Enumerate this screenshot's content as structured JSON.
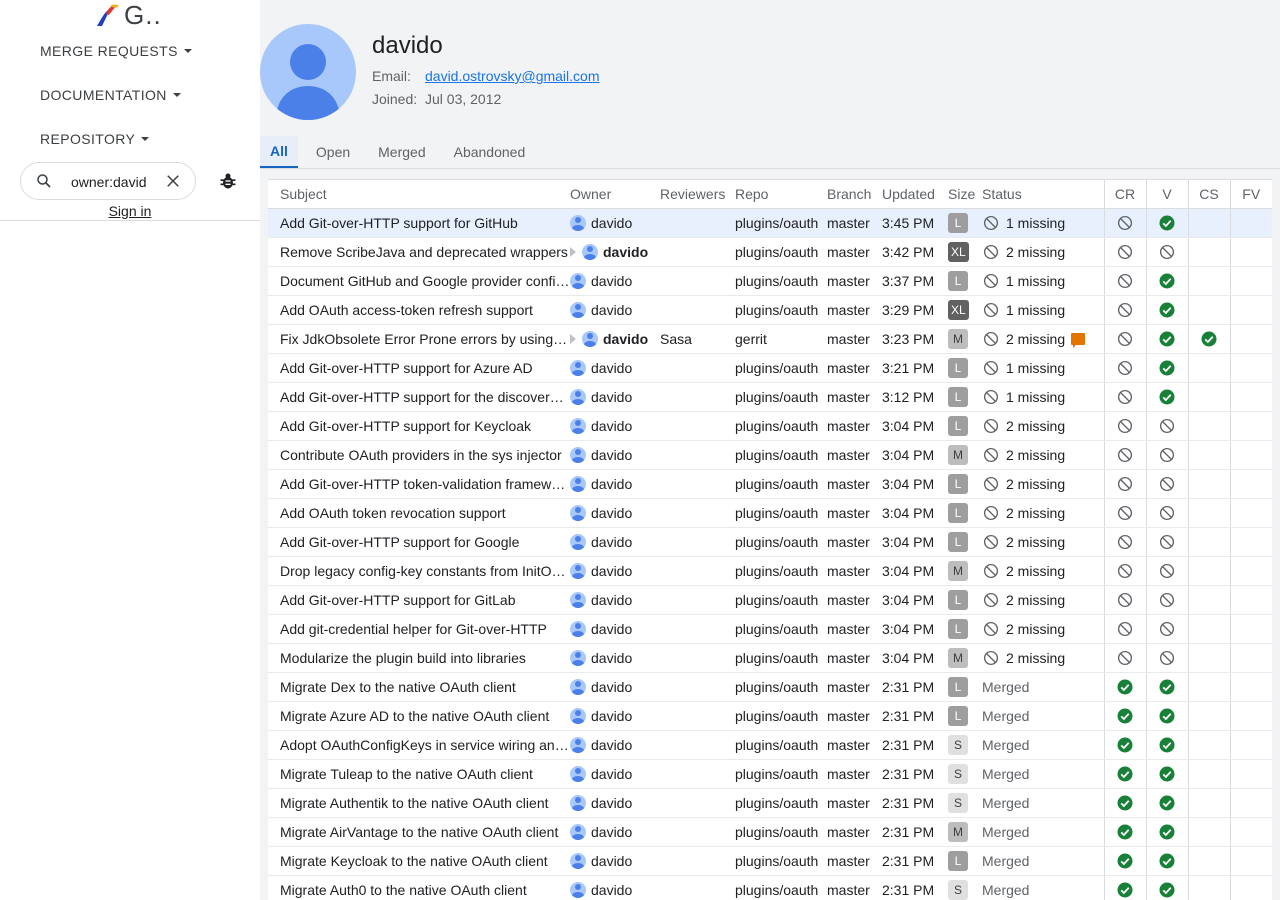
{
  "app": {
    "title": "G.."
  },
  "nav": {
    "merge_requests": "MERGE REQUESTS",
    "documentation": "DOCUMENTATION",
    "repository": "REPOSITORY"
  },
  "search": {
    "value": "owner:davido"
  },
  "auth": {
    "sign_in": "Sign in"
  },
  "user": {
    "name": "davido",
    "email_label": "Email:",
    "email": "david.ostrovsky@gmail.com",
    "joined_label": "Joined:",
    "joined": "Jul 03, 2012"
  },
  "tabs": [
    "All",
    "Open",
    "Merged",
    "Abandoned"
  ],
  "active_tab": "All",
  "table": {
    "headers": {
      "subject": "Subject",
      "owner": "Owner",
      "reviewers": "Reviewers",
      "repo": "Repo",
      "branch": "Branch",
      "updated": "Updated",
      "size": "Size",
      "status": "Status",
      "cr": "CR",
      "v": "V",
      "cs": "CS",
      "fv": "FV"
    },
    "rows": [
      {
        "subject": "Add Git-over-HTTP support for GitHub",
        "owner": "davido",
        "attention": false,
        "reviewers": "",
        "repo": "plugins/oauth",
        "branch": "master",
        "updated": "3:45 PM",
        "size": "L",
        "status": "1 missing",
        "status_type": "missing",
        "comment": false,
        "cr": "blocked",
        "v": "ok",
        "cs": "",
        "fv": "",
        "selected": true
      },
      {
        "subject": "Remove ScribeJava and deprecated wrappers",
        "owner": "davido",
        "attention": true,
        "reviewers": "",
        "repo": "plugins/oauth",
        "branch": "master",
        "updated": "3:42 PM",
        "size": "XL",
        "status": "2 missing",
        "status_type": "missing",
        "comment": false,
        "cr": "blocked",
        "v": "blocked",
        "cs": "",
        "fv": ""
      },
      {
        "subject": "Document GitHub and Google provider confi…",
        "owner": "davido",
        "attention": false,
        "reviewers": "",
        "repo": "plugins/oauth",
        "branch": "master",
        "updated": "3:37 PM",
        "size": "L",
        "status": "1 missing",
        "status_type": "missing",
        "comment": false,
        "cr": "blocked",
        "v": "ok",
        "cs": "",
        "fv": ""
      },
      {
        "subject": "Add OAuth access-token refresh support",
        "owner": "davido",
        "attention": false,
        "reviewers": "",
        "repo": "plugins/oauth",
        "branch": "master",
        "updated": "3:29 PM",
        "size": "XL",
        "status": "1 missing",
        "status_type": "missing",
        "comment": false,
        "cr": "blocked",
        "v": "ok",
        "cs": "",
        "fv": ""
      },
      {
        "subject": "Fix JdkObsolete Error Prone errors by using …",
        "owner": "davido",
        "attention": true,
        "reviewers": "Sasa",
        "repo": "gerrit",
        "branch": "master",
        "updated": "3:23 PM",
        "size": "M",
        "status": "2 missing",
        "status_type": "missing",
        "comment": true,
        "cr": "blocked",
        "v": "ok",
        "cs": "ok",
        "fv": ""
      },
      {
        "subject": "Add Git-over-HTTP support for Azure AD",
        "owner": "davido",
        "attention": false,
        "reviewers": "",
        "repo": "plugins/oauth",
        "branch": "master",
        "updated": "3:21 PM",
        "size": "L",
        "status": "1 missing",
        "status_type": "missing",
        "comment": false,
        "cr": "blocked",
        "v": "ok",
        "cs": "",
        "fv": ""
      },
      {
        "subject": "Add Git-over-HTTP support for the discovery…",
        "owner": "davido",
        "attention": false,
        "reviewers": "",
        "repo": "plugins/oauth",
        "branch": "master",
        "updated": "3:12 PM",
        "size": "L",
        "status": "1 missing",
        "status_type": "missing",
        "comment": false,
        "cr": "blocked",
        "v": "ok",
        "cs": "",
        "fv": ""
      },
      {
        "subject": "Add Git-over-HTTP support for Keycloak",
        "owner": "davido",
        "attention": false,
        "reviewers": "",
        "repo": "plugins/oauth",
        "branch": "master",
        "updated": "3:04 PM",
        "size": "L",
        "status": "2 missing",
        "status_type": "missing",
        "comment": false,
        "cr": "blocked",
        "v": "blocked",
        "cs": "",
        "fv": ""
      },
      {
        "subject": "Contribute OAuth providers in the sys injector",
        "owner": "davido",
        "attention": false,
        "reviewers": "",
        "repo": "plugins/oauth",
        "branch": "master",
        "updated": "3:04 PM",
        "size": "M",
        "status": "2 missing",
        "status_type": "missing",
        "comment": false,
        "cr": "blocked",
        "v": "blocked",
        "cs": "",
        "fv": ""
      },
      {
        "subject": "Add Git-over-HTTP token-validation framework",
        "owner": "davido",
        "attention": false,
        "reviewers": "",
        "repo": "plugins/oauth",
        "branch": "master",
        "updated": "3:04 PM",
        "size": "L",
        "status": "2 missing",
        "status_type": "missing",
        "comment": false,
        "cr": "blocked",
        "v": "blocked",
        "cs": "",
        "fv": ""
      },
      {
        "subject": "Add OAuth token revocation support",
        "owner": "davido",
        "attention": false,
        "reviewers": "",
        "repo": "plugins/oauth",
        "branch": "master",
        "updated": "3:04 PM",
        "size": "L",
        "status": "2 missing",
        "status_type": "missing",
        "comment": false,
        "cr": "blocked",
        "v": "blocked",
        "cs": "",
        "fv": ""
      },
      {
        "subject": "Add Git-over-HTTP support for Google",
        "owner": "davido",
        "attention": false,
        "reviewers": "",
        "repo": "plugins/oauth",
        "branch": "master",
        "updated": "3:04 PM",
        "size": "L",
        "status": "2 missing",
        "status_type": "missing",
        "comment": false,
        "cr": "blocked",
        "v": "blocked",
        "cs": "",
        "fv": ""
      },
      {
        "subject": "Drop legacy config-key constants from InitO…",
        "owner": "davido",
        "attention": false,
        "reviewers": "",
        "repo": "plugins/oauth",
        "branch": "master",
        "updated": "3:04 PM",
        "size": "M",
        "status": "2 missing",
        "status_type": "missing",
        "comment": false,
        "cr": "blocked",
        "v": "blocked",
        "cs": "",
        "fv": ""
      },
      {
        "subject": "Add Git-over-HTTP support for GitLab",
        "owner": "davido",
        "attention": false,
        "reviewers": "",
        "repo": "plugins/oauth",
        "branch": "master",
        "updated": "3:04 PM",
        "size": "L",
        "status": "2 missing",
        "status_type": "missing",
        "comment": false,
        "cr": "blocked",
        "v": "blocked",
        "cs": "",
        "fv": ""
      },
      {
        "subject": "Add git-credential helper for Git-over-HTTP",
        "owner": "davido",
        "attention": false,
        "reviewers": "",
        "repo": "plugins/oauth",
        "branch": "master",
        "updated": "3:04 PM",
        "size": "L",
        "status": "2 missing",
        "status_type": "missing",
        "comment": false,
        "cr": "blocked",
        "v": "blocked",
        "cs": "",
        "fv": ""
      },
      {
        "subject": "Modularize the plugin build into libraries",
        "owner": "davido",
        "attention": false,
        "reviewers": "",
        "repo": "plugins/oauth",
        "branch": "master",
        "updated": "3:04 PM",
        "size": "M",
        "status": "2 missing",
        "status_type": "missing",
        "comment": false,
        "cr": "blocked",
        "v": "blocked",
        "cs": "",
        "fv": ""
      },
      {
        "subject": "Migrate Dex to the native OAuth client",
        "owner": "davido",
        "attention": false,
        "reviewers": "",
        "repo": "plugins/oauth",
        "branch": "master",
        "updated": "2:31 PM",
        "size": "L",
        "status": "Merged",
        "status_type": "merged",
        "comment": false,
        "cr": "ok",
        "v": "ok",
        "cs": "",
        "fv": ""
      },
      {
        "subject": "Migrate Azure AD to the native OAuth client",
        "owner": "davido",
        "attention": false,
        "reviewers": "",
        "repo": "plugins/oauth",
        "branch": "master",
        "updated": "2:31 PM",
        "size": "L",
        "status": "Merged",
        "status_type": "merged",
        "comment": false,
        "cr": "ok",
        "v": "ok",
        "cs": "",
        "fv": ""
      },
      {
        "subject": "Adopt OAuthConfigKeys in service wiring an…",
        "owner": "davido",
        "attention": false,
        "reviewers": "",
        "repo": "plugins/oauth",
        "branch": "master",
        "updated": "2:31 PM",
        "size": "S",
        "status": "Merged",
        "status_type": "merged",
        "comment": false,
        "cr": "ok",
        "v": "ok",
        "cs": "",
        "fv": ""
      },
      {
        "subject": "Migrate Tuleap to the native OAuth client",
        "owner": "davido",
        "attention": false,
        "reviewers": "",
        "repo": "plugins/oauth",
        "branch": "master",
        "updated": "2:31 PM",
        "size": "S",
        "status": "Merged",
        "status_type": "merged",
        "comment": false,
        "cr": "ok",
        "v": "ok",
        "cs": "",
        "fv": ""
      },
      {
        "subject": "Migrate Authentik to the native OAuth client",
        "owner": "davido",
        "attention": false,
        "reviewers": "",
        "repo": "plugins/oauth",
        "branch": "master",
        "updated": "2:31 PM",
        "size": "S",
        "status": "Merged",
        "status_type": "merged",
        "comment": false,
        "cr": "ok",
        "v": "ok",
        "cs": "",
        "fv": ""
      },
      {
        "subject": "Migrate AirVantage to the native OAuth client",
        "owner": "davido",
        "attention": false,
        "reviewers": "",
        "repo": "plugins/oauth",
        "branch": "master",
        "updated": "2:31 PM",
        "size": "M",
        "status": "Merged",
        "status_type": "merged",
        "comment": false,
        "cr": "ok",
        "v": "ok",
        "cs": "",
        "fv": ""
      },
      {
        "subject": "Migrate Keycloak to the native OAuth client",
        "owner": "davido",
        "attention": false,
        "reviewers": "",
        "repo": "plugins/oauth",
        "branch": "master",
        "updated": "2:31 PM",
        "size": "L",
        "status": "Merged",
        "status_type": "merged",
        "comment": false,
        "cr": "ok",
        "v": "ok",
        "cs": "",
        "fv": ""
      },
      {
        "subject": "Migrate Auth0 to the native OAuth client",
        "owner": "davido",
        "attention": false,
        "reviewers": "",
        "repo": "plugins/oauth",
        "branch": "master",
        "updated": "2:31 PM",
        "size": "S",
        "status": "Merged",
        "status_type": "merged",
        "comment": false,
        "cr": "ok",
        "v": "ok",
        "cs": "",
        "fv": ""
      }
    ]
  },
  "colors": {
    "approved": "#188038",
    "blocked": "#5f6368",
    "link": "#1a73e8",
    "comment": "#e37400",
    "active_tab": "#1565c0"
  }
}
